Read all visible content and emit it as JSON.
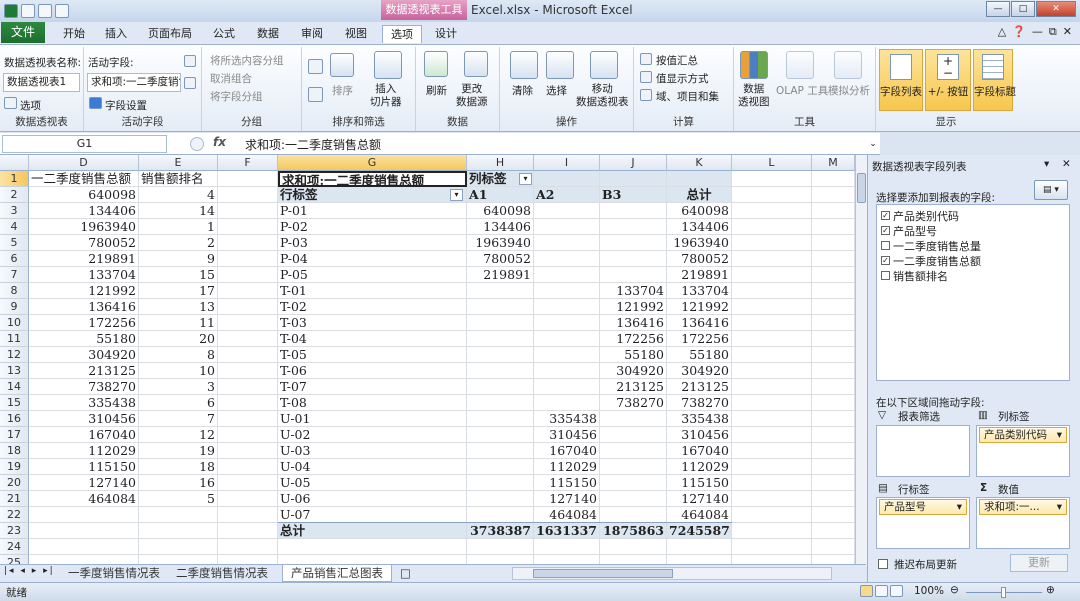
{
  "app": {
    "context_tab": "数据透视表工具",
    "title": "Excel.xlsx - Microsoft Excel"
  },
  "tabs": {
    "file": "文件",
    "home": "开始",
    "insert": "插入",
    "layout": "页面布局",
    "formula": "公式",
    "data": "数据",
    "review": "审阅",
    "view": "视图",
    "options": "选项",
    "design": "设计"
  },
  "ribbon": {
    "pt_name_label": "数据透视表名称:",
    "pt_name_value": "数据透视表1",
    "pt_options": "选项",
    "group_pt": "数据透视表",
    "active_field_label": "活动字段:",
    "active_field_value": "求和项:一二季度销售",
    "field_settings": "字段设置",
    "group_active": "活动字段",
    "group_sel": "将所选内容分组",
    "ungroup": "取消组合",
    "group_field": "将字段分组",
    "group_group": "分组",
    "sort": "排序",
    "insert_slicer": "插入\n切片器",
    "group_sort": "排序和筛选",
    "refresh": "刷新",
    "change_source": "更改\n数据源",
    "group_data": "数据",
    "clear": "清除",
    "select": "选择",
    "move_pt": "移动\n数据透视表",
    "group_ops": "操作",
    "summarize_by": "按值汇总",
    "show_values_as": "值显示方式",
    "fields_items_sets": "域、项目和集",
    "group_calc": "计算",
    "pivotchart": "数据\n透视图",
    "olap_tools": "OLAP 工具",
    "whatif": "模拟分析",
    "group_tools": "工具",
    "field_list": "字段列表",
    "plus_minus": "+/- 按钮",
    "field_headers": "字段标题",
    "group_show": "显示"
  },
  "formula_bar": {
    "name_box": "G1",
    "fx": "fx",
    "content": "求和项:一二季度销售总额"
  },
  "columns": [
    "D",
    "E",
    "F",
    "G",
    "H",
    "I",
    "J",
    "K",
    "L",
    "M"
  ],
  "rows": [
    "1",
    "2",
    "3",
    "4",
    "5",
    "6",
    "7",
    "8",
    "9",
    "10",
    "11",
    "12",
    "13",
    "14",
    "15",
    "16",
    "17",
    "18",
    "19",
    "20",
    "21",
    "22",
    "23",
    "24",
    "25"
  ],
  "sheet": {
    "d_header": "一二季度销售总额",
    "e_header": "销售额排名",
    "d_values": [
      "640098",
      "134406",
      "1963940",
      "780052",
      "219891",
      "133704",
      "121992",
      "136416",
      "172256",
      "55180",
      "304920",
      "213125",
      "738270",
      "335438",
      "310456",
      "167040",
      "112029",
      "115150",
      "127140",
      "464084"
    ],
    "e_values": [
      "4",
      "14",
      "1",
      "2",
      "9",
      "15",
      "17",
      "13",
      "11",
      "20",
      "8",
      "10",
      "3",
      "6",
      "7",
      "12",
      "19",
      "18",
      "16",
      "5"
    ]
  },
  "pivot": {
    "title": "求和项:一二季度销售总额",
    "col_label": "列标签",
    "row_label": "行标签",
    "col_headers": [
      "A1",
      "A2",
      "B3",
      "总计"
    ],
    "rows": [
      {
        "label": "P-01",
        "a1": "640098",
        "a2": "",
        "b3": "",
        "total": "640098"
      },
      {
        "label": "P-02",
        "a1": "134406",
        "a2": "",
        "b3": "",
        "total": "134406"
      },
      {
        "label": "P-03",
        "a1": "1963940",
        "a2": "",
        "b3": "",
        "total": "1963940"
      },
      {
        "label": "P-04",
        "a1": "780052",
        "a2": "",
        "b3": "",
        "total": "780052"
      },
      {
        "label": "P-05",
        "a1": "219891",
        "a2": "",
        "b3": "",
        "total": "219891"
      },
      {
        "label": "T-01",
        "a1": "",
        "a2": "",
        "b3": "133704",
        "total": "133704"
      },
      {
        "label": "T-02",
        "a1": "",
        "a2": "",
        "b3": "121992",
        "total": "121992"
      },
      {
        "label": "T-03",
        "a1": "",
        "a2": "",
        "b3": "136416",
        "total": "136416"
      },
      {
        "label": "T-04",
        "a1": "",
        "a2": "",
        "b3": "172256",
        "total": "172256"
      },
      {
        "label": "T-05",
        "a1": "",
        "a2": "",
        "b3": "55180",
        "total": "55180"
      },
      {
        "label": "T-06",
        "a1": "",
        "a2": "",
        "b3": "304920",
        "total": "304920"
      },
      {
        "label": "T-07",
        "a1": "",
        "a2": "",
        "b3": "213125",
        "total": "213125"
      },
      {
        "label": "T-08",
        "a1": "",
        "a2": "",
        "b3": "738270",
        "total": "738270"
      },
      {
        "label": "U-01",
        "a1": "",
        "a2": "335438",
        "b3": "",
        "total": "335438"
      },
      {
        "label": "U-02",
        "a1": "",
        "a2": "310456",
        "b3": "",
        "total": "310456"
      },
      {
        "label": "U-03",
        "a1": "",
        "a2": "167040",
        "b3": "",
        "total": "167040"
      },
      {
        "label": "U-04",
        "a1": "",
        "a2": "112029",
        "b3": "",
        "total": "112029"
      },
      {
        "label": "U-05",
        "a1": "",
        "a2": "115150",
        "b3": "",
        "total": "115150"
      },
      {
        "label": "U-06",
        "a1": "",
        "a2": "127140",
        "b3": "",
        "total": "127140"
      },
      {
        "label": "U-07",
        "a1": "",
        "a2": "464084",
        "b3": "",
        "total": "464084"
      }
    ],
    "total_label": "总计",
    "total_a1": "3738387",
    "total_a2": "1631337",
    "total_b3": "1875863",
    "total_all": "7245587"
  },
  "sheet_tabs": [
    "一季度销售情况表",
    "二季度销售情况表",
    "产品销售汇总图表"
  ],
  "status": {
    "ready": "就绪",
    "zoom": "100%"
  },
  "panel": {
    "title": "数据透视表字段列表",
    "choose_label": "选择要添加到报表的字段:",
    "fields": [
      {
        "name": "产品类别代码",
        "checked": true
      },
      {
        "name": "产品型号",
        "checked": true
      },
      {
        "name": "一二季度销售总量",
        "checked": false
      },
      {
        "name": "一二季度销售总额",
        "checked": true
      },
      {
        "name": "销售额排名",
        "checked": false
      }
    ],
    "drag_label": "在以下区域间拖动字段:",
    "report_filter": "报表筛选",
    "col_labels": "列标签",
    "col_item": "产品类别代码",
    "row_labels": "行标签",
    "row_item": "产品型号",
    "values": "数值",
    "values_item": "求和项:一...",
    "defer": "推迟布局更新",
    "update": "更新"
  }
}
